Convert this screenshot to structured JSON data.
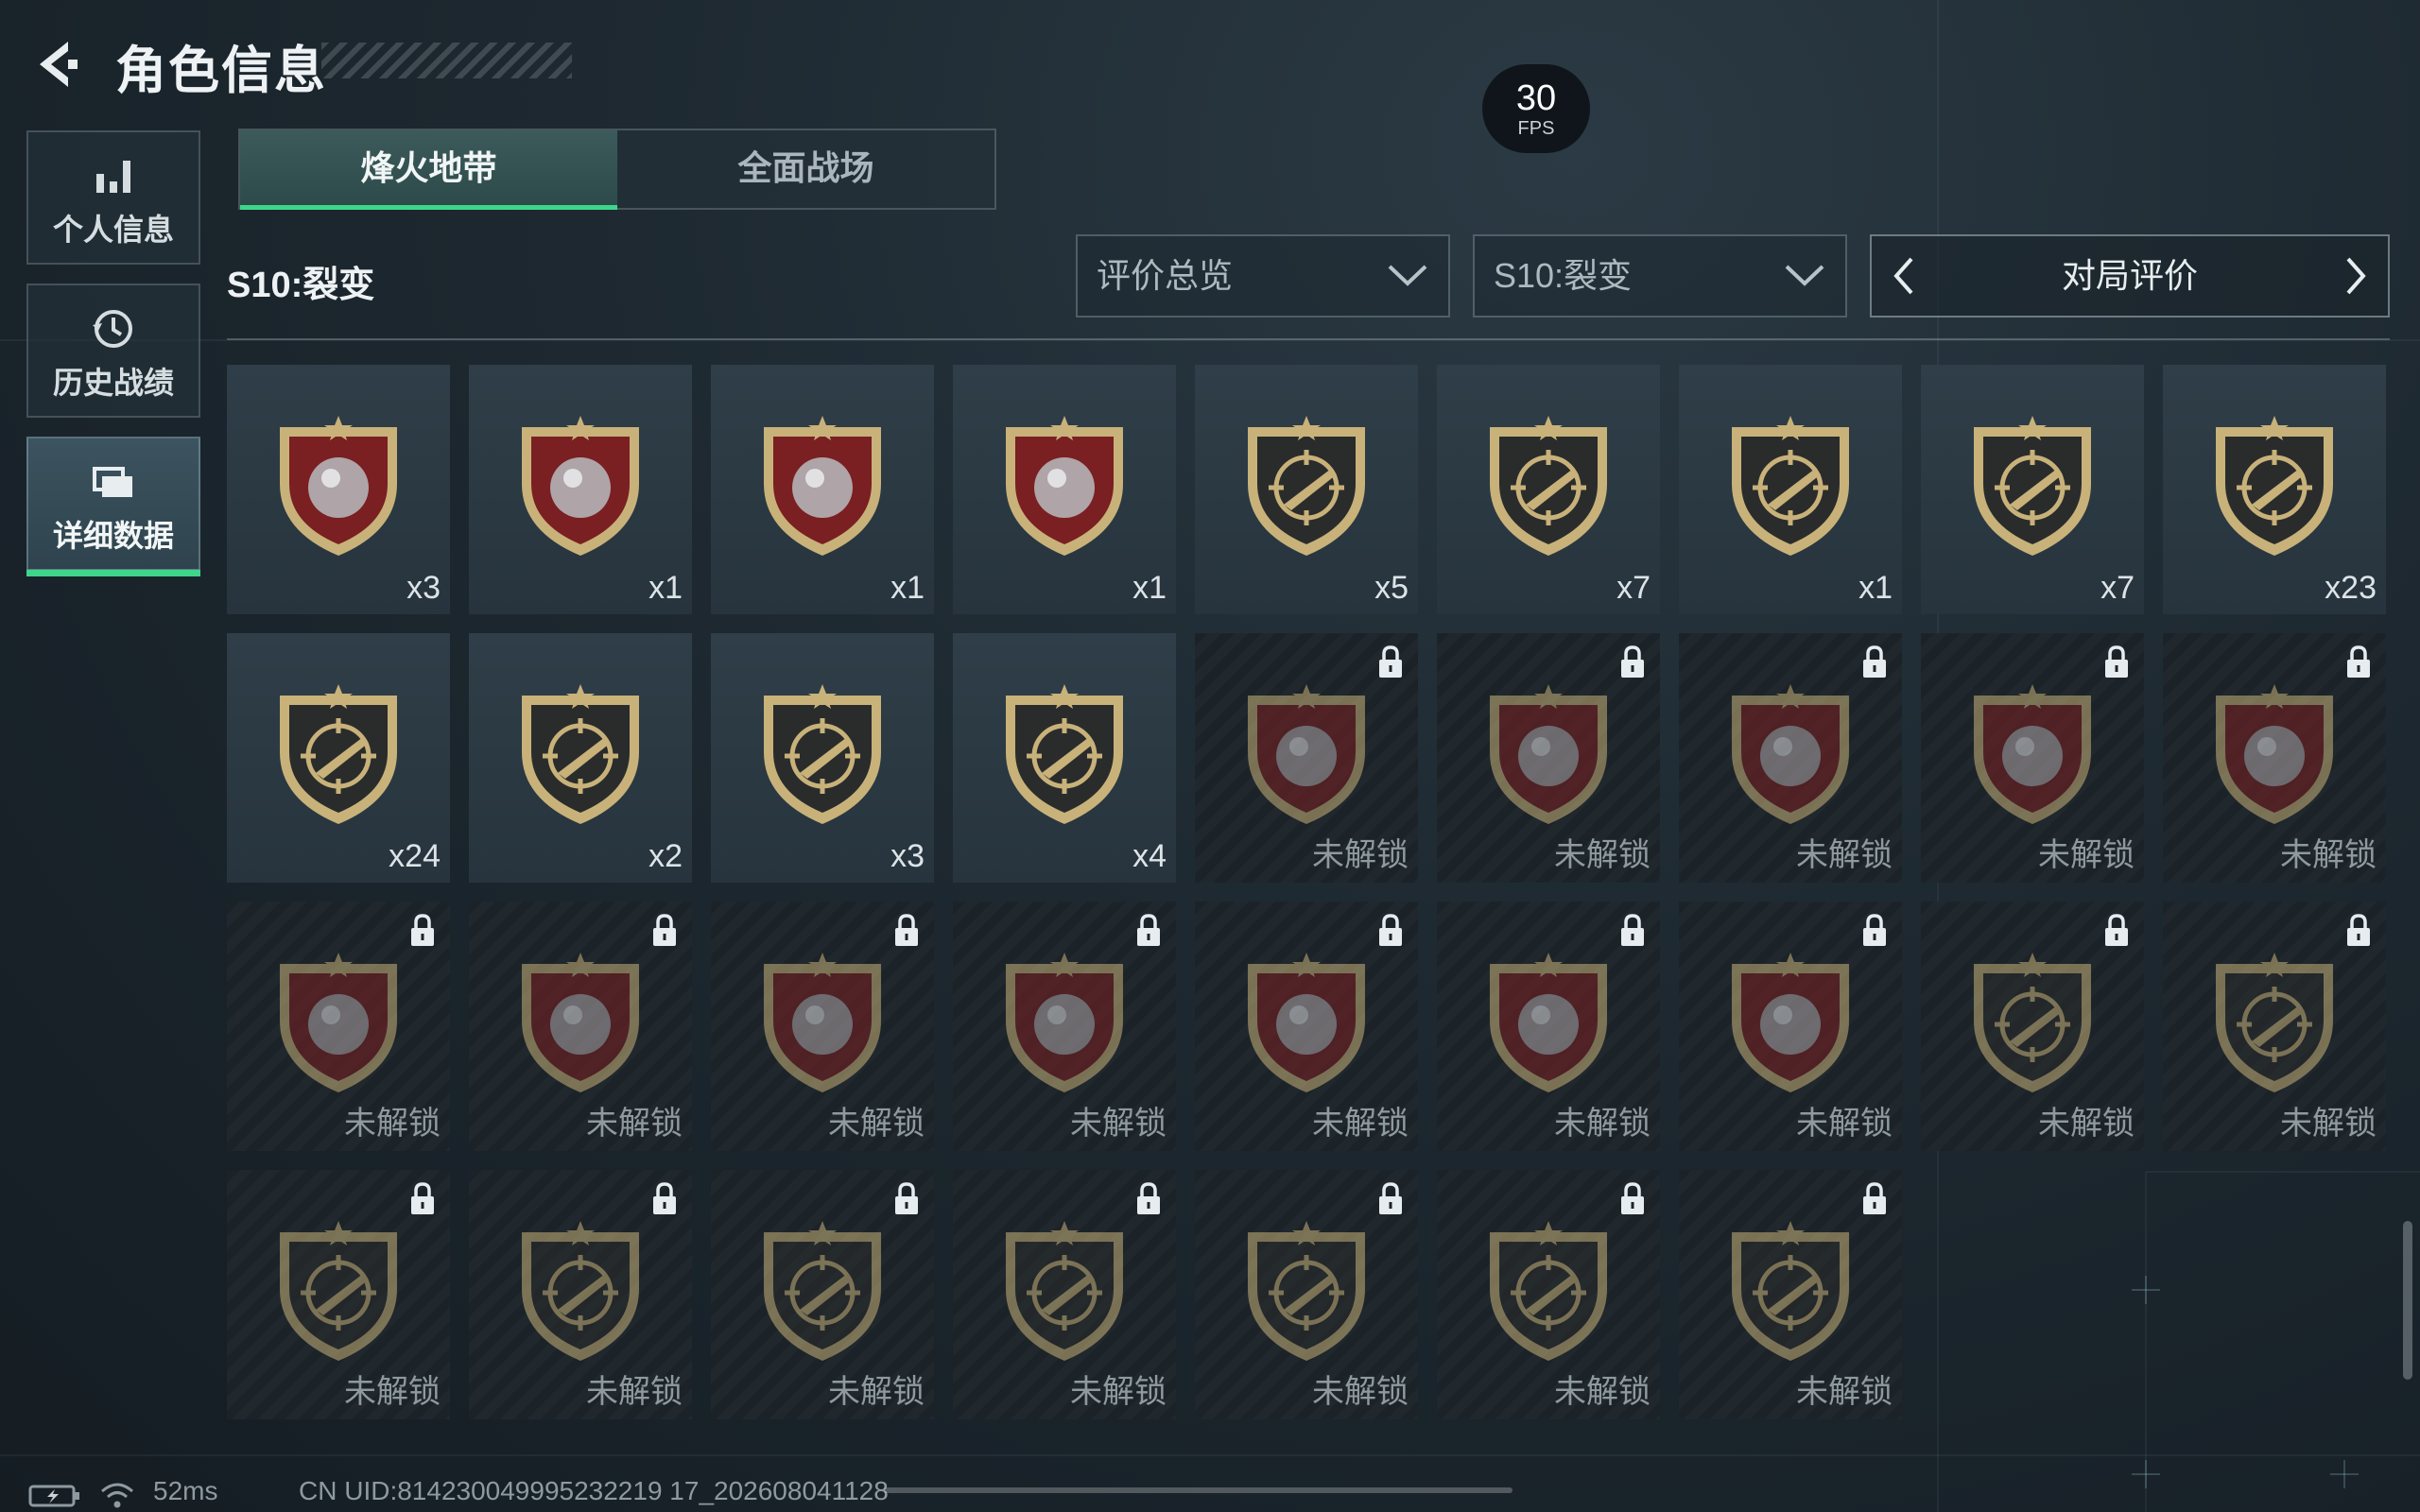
{
  "header": {
    "title": "角色信息"
  },
  "fps": {
    "value": "30",
    "unit": "FPS"
  },
  "nav": {
    "items": [
      {
        "label": "个人信息",
        "icon": "bar-chart-icon"
      },
      {
        "label": "历史战绩",
        "icon": "history-clock-icon"
      },
      {
        "label": "详细数据",
        "icon": "folder-icon",
        "active": true
      }
    ]
  },
  "tabs": [
    {
      "label": "烽火地带",
      "active": true
    },
    {
      "label": "全面战场",
      "active": false
    }
  ],
  "season_title": "S10:裂变",
  "filters": {
    "overview": "评价总览",
    "season": "S10:裂变",
    "pager_label": "对局评价"
  },
  "medals": [
    {
      "count": "x3",
      "locked": false,
      "icon": "diamond-icon",
      "shield": "red"
    },
    {
      "count": "x1",
      "locked": false,
      "icon": "metal-plate-icon",
      "shield": "red"
    },
    {
      "count": "x1",
      "locked": false,
      "icon": "device-icon",
      "shield": "red"
    },
    {
      "count": "x1",
      "locked": false,
      "icon": "painting-icon",
      "shield": "red"
    },
    {
      "count": "x5",
      "locked": false,
      "icon": "rifle-crosshair-icon",
      "shield": "dark"
    },
    {
      "count": "x7",
      "locked": false,
      "icon": "rifle-crosshair-icon",
      "shield": "dark"
    },
    {
      "count": "x1",
      "locked": false,
      "icon": "rifle-crosshair-icon",
      "shield": "dark"
    },
    {
      "count": "x7",
      "locked": false,
      "icon": "knife-crosshair-icon",
      "shield": "dark"
    },
    {
      "count": "x23",
      "locked": false,
      "icon": "skull-star-icon",
      "shield": "dark"
    },
    {
      "count": "x24",
      "locked": false,
      "icon": "wreath-emblem-icon",
      "shield": "dark"
    },
    {
      "count": "x2",
      "locked": false,
      "icon": "wreath-emblem-icon",
      "shield": "dark"
    },
    {
      "count": "x3",
      "locked": false,
      "icon": "hooded-figure-icon",
      "shield": "dark"
    },
    {
      "count": "x4",
      "locked": false,
      "icon": "operator-portrait-icon",
      "shield": "dark"
    },
    {
      "count": "未解锁",
      "locked": true,
      "icon": "orb-icon",
      "shield": "red"
    },
    {
      "count": "未解锁",
      "locked": true,
      "icon": "tank-icon",
      "shield": "red"
    },
    {
      "count": "未解锁",
      "locked": true,
      "icon": "computer-icon",
      "shield": "red"
    },
    {
      "count": "未解锁",
      "locked": true,
      "icon": "circuit-board-icon",
      "shield": "red"
    },
    {
      "count": "未解锁",
      "locked": true,
      "icon": "battery-pack-icon",
      "shield": "red"
    },
    {
      "count": "未解锁",
      "locked": true,
      "icon": "machine-icon",
      "shield": "red"
    },
    {
      "count": "未解锁",
      "locked": true,
      "icon": "lantern-icon",
      "shield": "red"
    },
    {
      "count": "未解锁",
      "locked": true,
      "icon": "egg-icon",
      "shield": "red"
    },
    {
      "count": "未解锁",
      "locked": true,
      "icon": "chessboard-icon",
      "shield": "red"
    },
    {
      "count": "未解锁",
      "locked": true,
      "icon": "engine-icon",
      "shield": "red"
    },
    {
      "count": "未解锁",
      "locked": true,
      "icon": "reactor-icon",
      "shield": "red"
    },
    {
      "count": "未解锁",
      "locked": true,
      "icon": "crystal-icon",
      "shield": "red"
    },
    {
      "count": "未解锁",
      "locked": true,
      "icon": "shotgun-crosshair-icon",
      "shield": "dark"
    },
    {
      "count": "未解锁",
      "locked": true,
      "icon": "rifle-crosshair-icon",
      "shield": "dark"
    },
    {
      "count": "未解锁",
      "locked": true,
      "icon": "sniper-crosshair-icon",
      "shield": "dark"
    },
    {
      "count": "未解锁",
      "locked": true,
      "icon": "pistol-crosshair-icon",
      "shield": "dark"
    },
    {
      "count": "未解锁",
      "locked": true,
      "icon": "beret-soldier-icon",
      "shield": "dark"
    },
    {
      "count": "未解锁",
      "locked": true,
      "icon": "skull-crosshair-icon",
      "shield": "dark"
    },
    {
      "count": "未解锁",
      "locked": true,
      "icon": "mask-crosshair-icon",
      "shield": "dark"
    },
    {
      "count": "未解锁",
      "locked": true,
      "icon": "operator-portrait-icon",
      "shield": "dark"
    },
    {
      "count": "未解锁",
      "locked": true,
      "icon": "bald-operator-icon",
      "shield": "dark"
    }
  ],
  "footer": {
    "ping": "52ms",
    "uid": "CN UID:814230049995232219 17_202608041128"
  },
  "colors": {
    "accent": "#3ed68a",
    "gold": "#c8b27a",
    "red_shield": "#7a1f22"
  }
}
